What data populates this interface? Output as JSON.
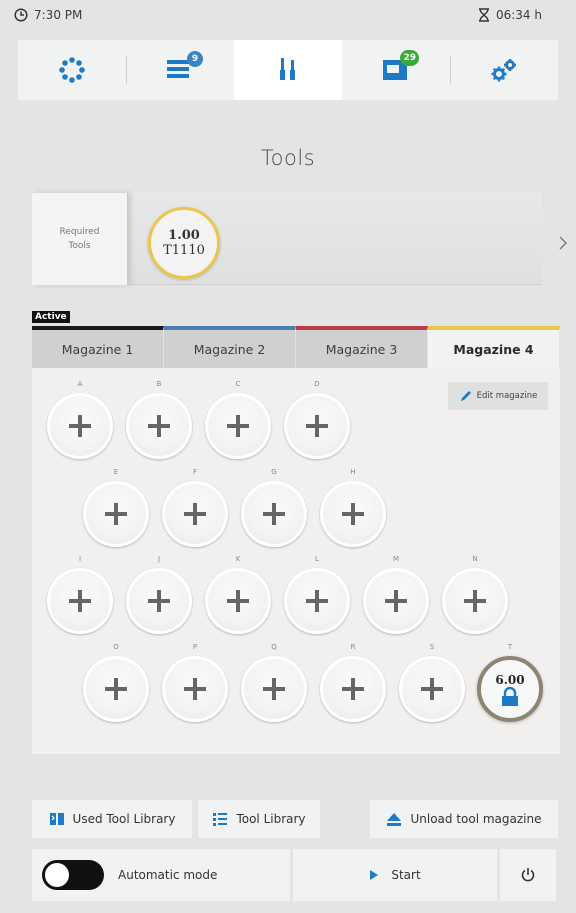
{
  "status": {
    "clock": "7:30 PM",
    "runtime": "06:34 h"
  },
  "nav": {
    "items": [
      {
        "name": "tool-changer-icon",
        "badge": ""
      },
      {
        "name": "job-list-icon",
        "badge": "9"
      },
      {
        "name": "tools-icon",
        "badge": ""
      },
      {
        "name": "machine-icon",
        "badge": "29"
      },
      {
        "name": "settings-icon",
        "badge": ""
      }
    ],
    "active_index": 2,
    "badge_colors": {
      "job": "#3b84c4",
      "machine": "#3aa93a"
    }
  },
  "page": {
    "title": "Tools"
  },
  "required_tools": {
    "label_line1": "Required",
    "label_line2": "Tools",
    "tool": {
      "value": "1.00",
      "id": "T1110"
    }
  },
  "magazine": {
    "active_label": "Active",
    "tabs": [
      {
        "label": "Magazine 1",
        "color": "#1a1a1a"
      },
      {
        "label": "Magazine 2",
        "color": "#4a7fb0"
      },
      {
        "label": "Magazine 3",
        "color": "#c0394a"
      },
      {
        "label": "Magazine 4",
        "color": "#ecc64a"
      }
    ],
    "selected_tab": 3,
    "edit_label": "Edit magazine",
    "slots": [
      {
        "letter": "A"
      },
      {
        "letter": "B"
      },
      {
        "letter": "C"
      },
      {
        "letter": "D"
      },
      {
        "letter": "E"
      },
      {
        "letter": "F"
      },
      {
        "letter": "G"
      },
      {
        "letter": "H"
      },
      {
        "letter": "I"
      },
      {
        "letter": "J"
      },
      {
        "letter": "K"
      },
      {
        "letter": "L"
      },
      {
        "letter": "M"
      },
      {
        "letter": "N"
      },
      {
        "letter": "O"
      },
      {
        "letter": "P"
      },
      {
        "letter": "Q"
      },
      {
        "letter": "R"
      },
      {
        "letter": "S"
      },
      {
        "letter": "T",
        "value": "6.00",
        "locked": true
      }
    ]
  },
  "actions": {
    "used_tool_library": "Used Tool Library",
    "tool_library": "Tool Library",
    "unload_magazine": "Unload tool magazine"
  },
  "footer": {
    "automatic_mode": "Automatic mode",
    "start": "Start"
  },
  "colors": {
    "accent_blue": "#1d7ac6",
    "gold": "#ecc64a"
  }
}
